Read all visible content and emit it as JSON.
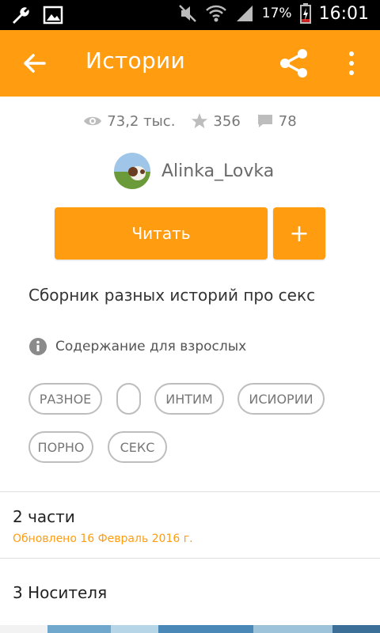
{
  "status_bar": {
    "battery": "17%",
    "time": "16:01"
  },
  "app_bar": {
    "title": "Истории",
    "back_icon": "arrow-left-icon",
    "share_icon": "share-icon",
    "more_icon": "more-vertical-icon"
  },
  "stats": {
    "views": "73,2 тыс.",
    "votes": "356",
    "comments": "78"
  },
  "author": {
    "name": "Alinka_Lovka"
  },
  "actions": {
    "read_label": "Читать",
    "add_label": "+"
  },
  "description": "Сборник разных историй про секс",
  "mature": {
    "label": "Содержание для взрослых"
  },
  "tags": [
    "РАЗНОЕ",
    "",
    "ИНТИМ",
    "ИСИОРИИ",
    "ПОРНО",
    "СЕКС"
  ],
  "parts": {
    "title": "2 части",
    "updated": "Обновлено 16 Февраль 2016 г."
  },
  "reading_lists": {
    "title": "3 Носителя"
  },
  "colors": {
    "accent": "#ff9c10",
    "tag_border": "#bdbdbd"
  }
}
